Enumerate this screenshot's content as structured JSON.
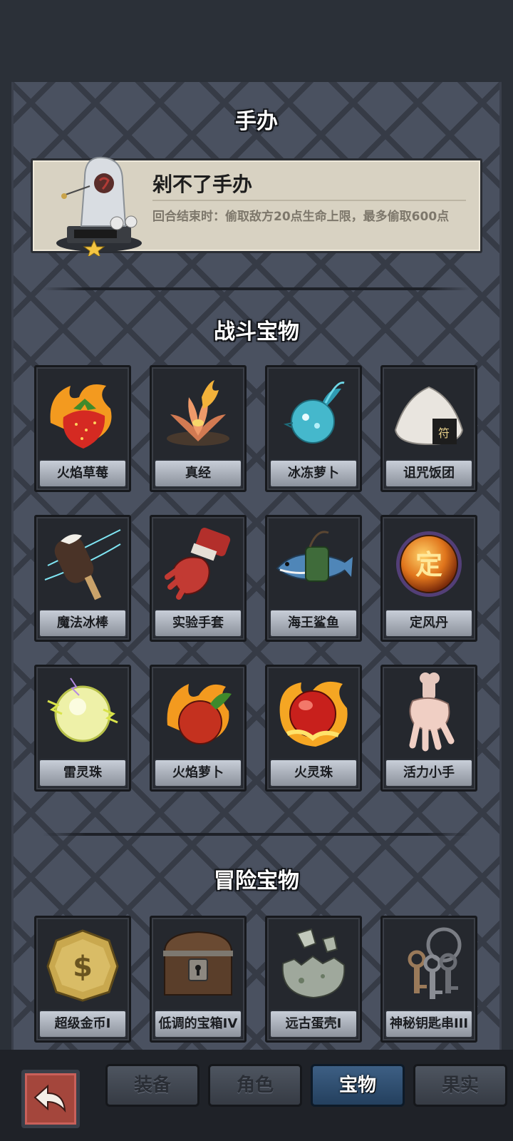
{
  "figure_section": {
    "title": "手办",
    "figure": {
      "name": "剁不了手办",
      "description": "回合结束时：偷取敌方20点生命上限，最多偷取600点",
      "rarity_stars": 1
    }
  },
  "combat_section": {
    "title": "战斗宝物",
    "items": [
      {
        "label": "火焰草莓",
        "icon": "flame-strawberry-icon"
      },
      {
        "label": "真经",
        "icon": "lotus-icon"
      },
      {
        "label": "冰冻萝卜",
        "icon": "frozen-radish-icon"
      },
      {
        "label": "诅咒饭团",
        "icon": "rice-ball-icon"
      },
      {
        "label": "魔法冰棒",
        "icon": "ice-pop-icon"
      },
      {
        "label": "实验手套",
        "icon": "glove-icon"
      },
      {
        "label": "海王鲨鱼",
        "icon": "shark-icon"
      },
      {
        "label": "定风丹",
        "icon": "orb-icon"
      },
      {
        "label": "雷灵珠",
        "icon": "thunder-orb-icon"
      },
      {
        "label": "火焰萝卜",
        "icon": "flame-radish-icon"
      },
      {
        "label": "火灵珠",
        "icon": "fire-orb-icon"
      },
      {
        "label": "活力小手",
        "icon": "hand-icon"
      }
    ],
    "orb_glyph": "定"
  },
  "adventure_section": {
    "title": "冒险宝物",
    "items": [
      {
        "label": "超级金币I",
        "icon": "gold-coin-icon"
      },
      {
        "label": "低调的宝箱IV",
        "icon": "treasure-chest-icon"
      },
      {
        "label": "远古蛋壳I",
        "icon": "eggshell-icon"
      },
      {
        "label": "神秘钥匙串III",
        "icon": "keys-icon"
      }
    ]
  },
  "bottom_tabs": {
    "back_icon": "back-arrow-icon",
    "tabs": [
      {
        "label": "装备",
        "active": false
      },
      {
        "label": "角色",
        "active": false
      },
      {
        "label": "宝物",
        "active": true
      },
      {
        "label": "果实",
        "active": false
      }
    ]
  },
  "colors": {
    "background": "#2b3038",
    "panel": "#4a5160",
    "active_tab": "#24405e",
    "card_bg": "#25282e"
  }
}
